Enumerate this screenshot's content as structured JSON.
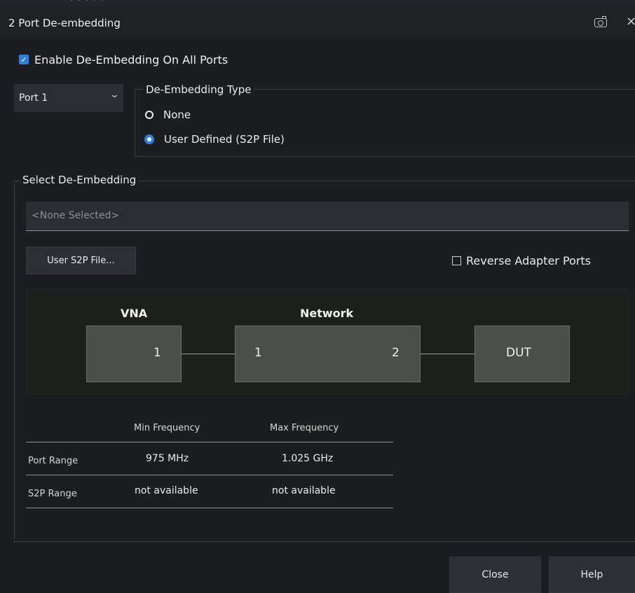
{
  "window": {
    "title": "2 Port De-embedding",
    "camera_icon": "camera-icon",
    "close_icon": "×"
  },
  "enable": {
    "checked": true,
    "label": "Enable De-Embedding On All Ports"
  },
  "port_select": {
    "value": "Port 1"
  },
  "type_group": {
    "legend": "De-Embedding Type",
    "options": [
      {
        "label": "None",
        "selected": false
      },
      {
        "label": "User Defined (S2P File)",
        "selected": true
      }
    ]
  },
  "select_group": {
    "legend": "Select De-Embedding",
    "file_field": {
      "value": "<None Selected>"
    },
    "user_file_button": "User S2P File...",
    "reverse": {
      "checked": false,
      "label": "Reverse Adapter Ports"
    }
  },
  "diagram": {
    "vna_label": "VNA",
    "network_label": "Network",
    "vna_port": "1",
    "net_port_in": "1",
    "net_port_out": "2",
    "dut_label": "DUT"
  },
  "freq_table": {
    "headers": [
      "Min Frequency",
      "Max Frequency"
    ],
    "rows": [
      {
        "label": "Port Range",
        "min": "975 MHz",
        "max": "1.025 GHz"
      },
      {
        "label": "S2P Range",
        "min": "not available",
        "max": "not available"
      }
    ]
  },
  "footer": {
    "close": "Close",
    "help": "Help"
  },
  "colors": {
    "accent": "#2f7fd6",
    "background": "#1b1d20",
    "block": "#4b4e4b"
  }
}
